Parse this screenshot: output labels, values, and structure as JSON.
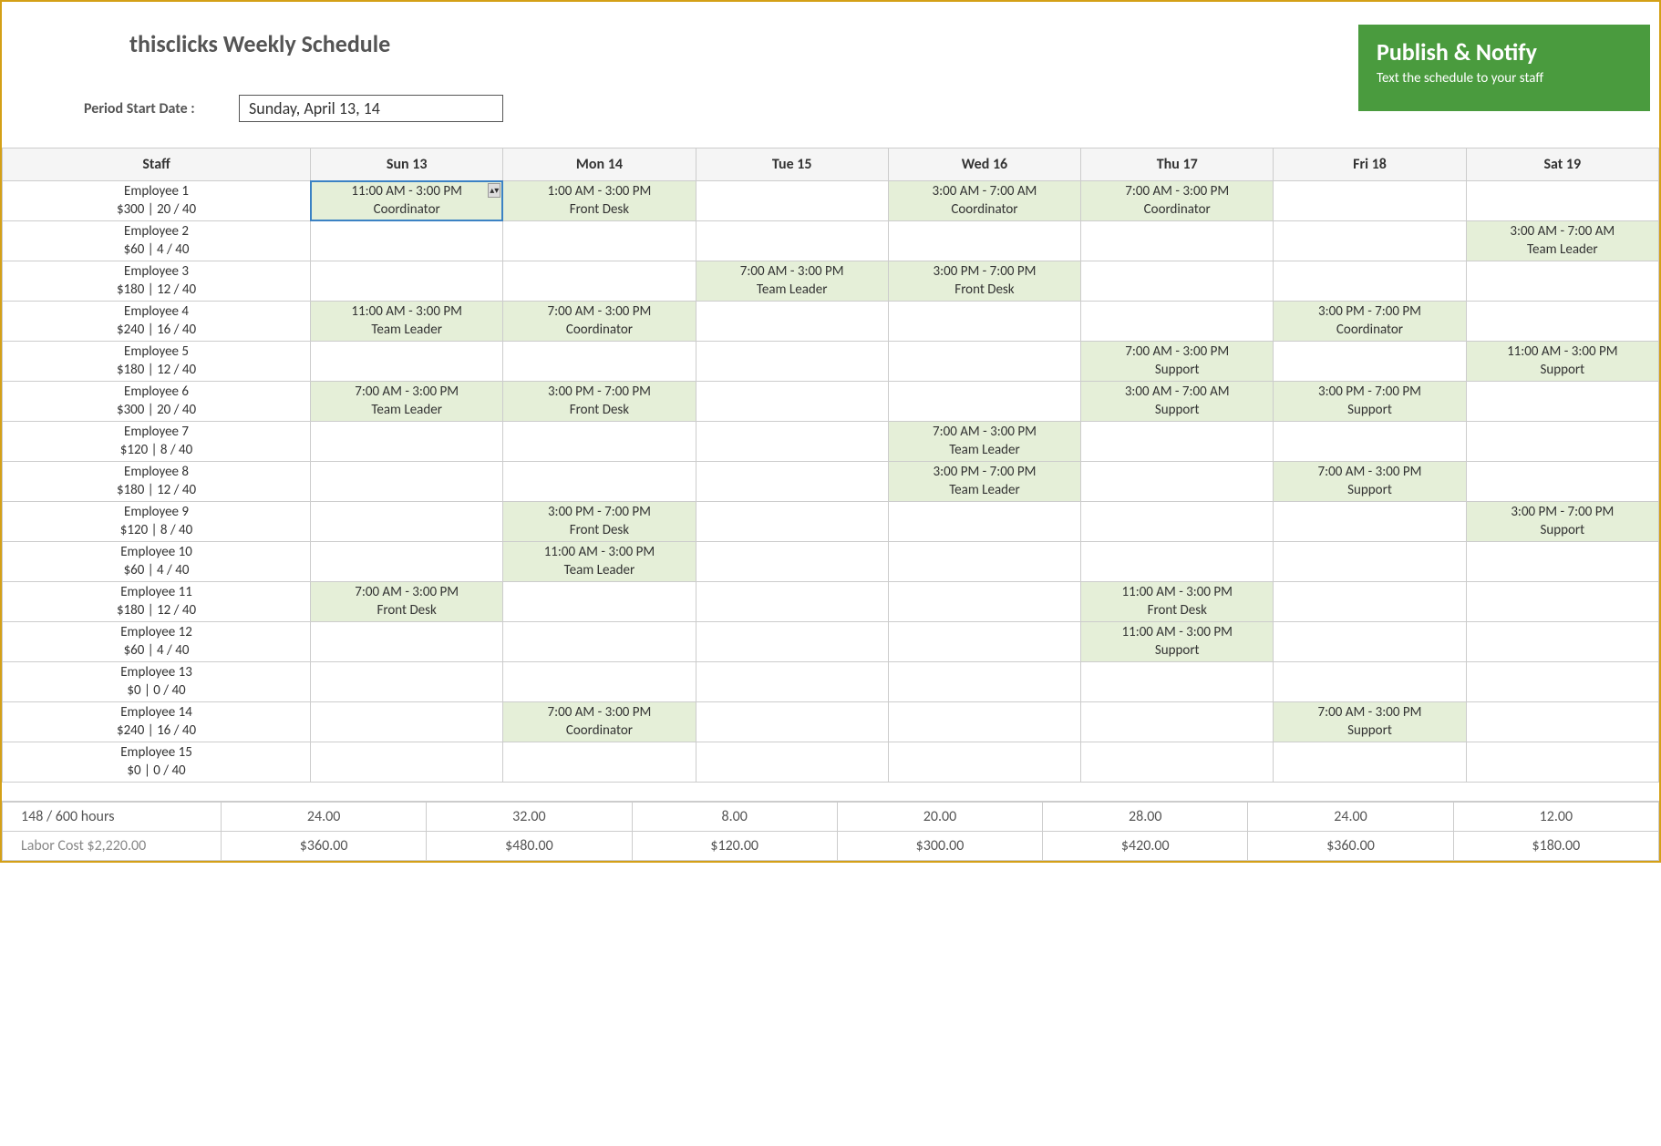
{
  "title": "thisclicks Weekly Schedule",
  "period_label": "Period Start Date :",
  "period_value": "Sunday, April 13, 14",
  "publish": {
    "title": "Publish & Notify",
    "subtitle": "Text the schedule to your staff"
  },
  "columns": [
    "Staff",
    "Sun 13",
    "Mon 14",
    "Tue 15",
    "Wed 16",
    "Thu 17",
    "Fri 18",
    "Sat 19"
  ],
  "rows": [
    {
      "name": "Employee 1",
      "meta": "$300 | 20 / 40",
      "shifts": [
        {
          "time": "11:00 AM - 3:00 PM",
          "role": "Coordinator",
          "active": true
        },
        {
          "time": "1:00 AM - 3:00 PM",
          "role": "Front Desk"
        },
        null,
        {
          "time": "3:00 AM - 7:00 AM",
          "role": "Coordinator"
        },
        {
          "time": "7:00 AM - 3:00 PM",
          "role": "Coordinator"
        },
        null,
        null
      ]
    },
    {
      "name": "Employee 2",
      "meta": "$60 | 4 / 40",
      "shifts": [
        null,
        null,
        null,
        null,
        null,
        null,
        {
          "time": "3:00 AM - 7:00 AM",
          "role": "Team Leader"
        }
      ]
    },
    {
      "name": "Employee 3",
      "meta": "$180 | 12 / 40",
      "shifts": [
        null,
        null,
        {
          "time": "7:00 AM - 3:00 PM",
          "role": "Team Leader"
        },
        {
          "time": "3:00 PM - 7:00 PM",
          "role": "Front Desk"
        },
        null,
        null,
        null
      ]
    },
    {
      "name": "Employee 4",
      "meta": "$240 | 16 / 40",
      "shifts": [
        {
          "time": "11:00 AM - 3:00 PM",
          "role": "Team Leader"
        },
        {
          "time": "7:00 AM - 3:00 PM",
          "role": "Coordinator"
        },
        null,
        null,
        null,
        {
          "time": "3:00 PM - 7:00 PM",
          "role": "Coordinator"
        },
        null
      ]
    },
    {
      "name": "Employee 5",
      "meta": "$180 | 12 / 40",
      "shifts": [
        null,
        null,
        null,
        null,
        {
          "time": "7:00 AM - 3:00 PM",
          "role": "Support"
        },
        null,
        {
          "time": "11:00 AM - 3:00 PM",
          "role": "Support"
        }
      ]
    },
    {
      "name": "Employee 6",
      "meta": "$300 | 20 / 40",
      "shifts": [
        {
          "time": "7:00 AM - 3:00 PM",
          "role": "Team Leader"
        },
        {
          "time": "3:00 PM - 7:00 PM",
          "role": "Front Desk"
        },
        null,
        null,
        {
          "time": "3:00 AM - 7:00 AM",
          "role": "Support"
        },
        {
          "time": "3:00 PM - 7:00 PM",
          "role": "Support"
        },
        null
      ]
    },
    {
      "name": "Employee 7",
      "meta": "$120 | 8 / 40",
      "shifts": [
        null,
        null,
        null,
        {
          "time": "7:00 AM - 3:00 PM",
          "role": "Team Leader"
        },
        null,
        null,
        null
      ]
    },
    {
      "name": "Employee 8",
      "meta": "$180 | 12 / 40",
      "shifts": [
        null,
        null,
        null,
        {
          "time": "3:00 PM - 7:00 PM",
          "role": "Team Leader"
        },
        null,
        {
          "time": "7:00 AM - 3:00 PM",
          "role": "Support"
        },
        null
      ]
    },
    {
      "name": "Employee 9",
      "meta": "$120 | 8 / 40",
      "shifts": [
        null,
        {
          "time": "3:00 PM - 7:00 PM",
          "role": "Front Desk"
        },
        null,
        null,
        null,
        null,
        {
          "time": "3:00 PM - 7:00 PM",
          "role": "Support"
        }
      ]
    },
    {
      "name": "Employee 10",
      "meta": "$60 | 4 / 40",
      "shifts": [
        null,
        {
          "time": "11:00 AM - 3:00 PM",
          "role": "Team Leader"
        },
        null,
        null,
        null,
        null,
        null
      ]
    },
    {
      "name": "Employee 11",
      "meta": "$180 | 12 / 40",
      "shifts": [
        {
          "time": "7:00 AM - 3:00 PM",
          "role": "Front Desk"
        },
        null,
        null,
        null,
        {
          "time": "11:00 AM - 3:00 PM",
          "role": "Front Desk"
        },
        null,
        null
      ]
    },
    {
      "name": "Employee 12",
      "meta": "$60 | 4 / 40",
      "shifts": [
        null,
        null,
        null,
        null,
        {
          "time": "11:00 AM - 3:00 PM",
          "role": "Support"
        },
        null,
        null
      ]
    },
    {
      "name": "Employee 13",
      "meta": "$0 | 0 / 40",
      "shifts": [
        null,
        null,
        null,
        null,
        null,
        null,
        null
      ]
    },
    {
      "name": "Employee 14",
      "meta": "$240 | 16 / 40",
      "shifts": [
        null,
        {
          "time": "7:00 AM - 3:00 PM",
          "role": "Coordinator"
        },
        null,
        null,
        null,
        {
          "time": "7:00 AM - 3:00 PM",
          "role": "Support"
        },
        null
      ]
    },
    {
      "name": "Employee 15",
      "meta": "$0 | 0 / 40",
      "shifts": [
        null,
        null,
        null,
        null,
        null,
        null,
        null
      ]
    }
  ],
  "footer": {
    "hours_label": "148 / 600 hours",
    "hours": [
      "24.00",
      "32.00",
      "8.00",
      "20.00",
      "28.00",
      "24.00",
      "12.00"
    ],
    "cost_label": "Labor Cost $2,220.00",
    "costs": [
      "$360.00",
      "$480.00",
      "$120.00",
      "$300.00",
      "$420.00",
      "$360.00",
      "$180.00"
    ]
  }
}
